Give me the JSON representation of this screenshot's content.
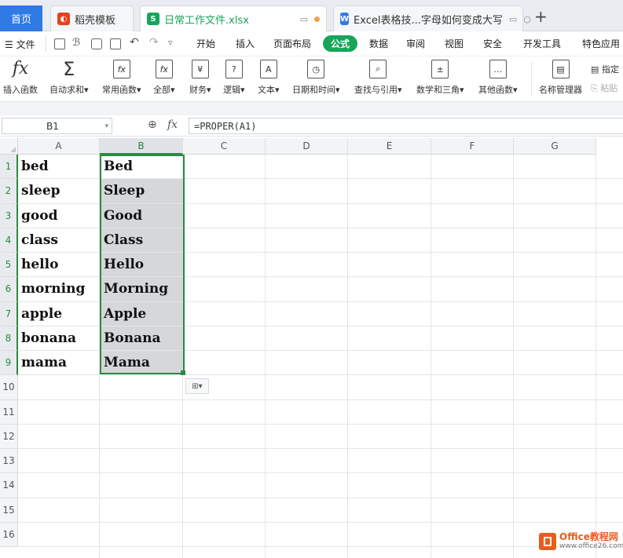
{
  "tabs": [
    {
      "label": "首页",
      "icon": "home"
    },
    {
      "label": "稻壳模板",
      "icon": "docer-icon"
    },
    {
      "label": "日常工作文件.xlsx",
      "icon": "sheet-icon"
    },
    {
      "label": "Excel表格技...字母如何变成大写",
      "icon": "doc-icon"
    }
  ],
  "new_tab": "+",
  "menu": [
    "文件",
    "开始",
    "插入",
    "页面布局",
    "公式",
    "数据",
    "审阅",
    "视图",
    "安全",
    "开发工具",
    "特色应用"
  ],
  "ribbon": [
    {
      "label": "插入函数",
      "icon": "fx"
    },
    {
      "label": "自动求和▾",
      "icon": "Σ"
    },
    {
      "label": "常用函数▾",
      "icon": "fx"
    },
    {
      "label": "全部▾",
      "icon": "fx"
    },
    {
      "label": "财务▾",
      "icon": "¥"
    },
    {
      "label": "逻辑▾",
      "icon": "?"
    },
    {
      "label": "文本▾",
      "icon": "A"
    },
    {
      "label": "日期和时间▾",
      "icon": "◷"
    },
    {
      "label": "查找与引用▾",
      "icon": "⌕"
    },
    {
      "label": "数学和三角▾",
      "icon": "±"
    },
    {
      "label": "其他函数▾",
      "icon": "…"
    },
    {
      "label": "名称管理器",
      "icon": "▤"
    }
  ],
  "ribbon_right": [
    "指定",
    "粘贴"
  ],
  "formula_bar": {
    "cell_ref": "B1",
    "fx": "fx",
    "formula": "=PROPER(A1)"
  },
  "columns": [
    "A",
    "B",
    "C",
    "D",
    "E",
    "F",
    "G"
  ],
  "rows": [
    "1",
    "2",
    "3",
    "4",
    "5",
    "6",
    "7",
    "8",
    "9",
    "10",
    "11",
    "12",
    "13",
    "14",
    "15",
    "16"
  ],
  "cells": [
    [
      "bed",
      "Bed"
    ],
    [
      "sleep",
      "Sleep"
    ],
    [
      "good",
      "Good"
    ],
    [
      "class",
      "Class"
    ],
    [
      "hello",
      "Hello"
    ],
    [
      "morning",
      "Morning"
    ],
    [
      "apple",
      "Apple"
    ],
    [
      "bonana",
      "Bonana"
    ],
    [
      "mama",
      "Mama"
    ]
  ],
  "watermark": {
    "title": "Office教程网",
    "url": "www.office26.com"
  },
  "colors": {
    "accent": "#17a559",
    "selection": "#2c8a3f",
    "home_tab": "#2f7ae5"
  }
}
